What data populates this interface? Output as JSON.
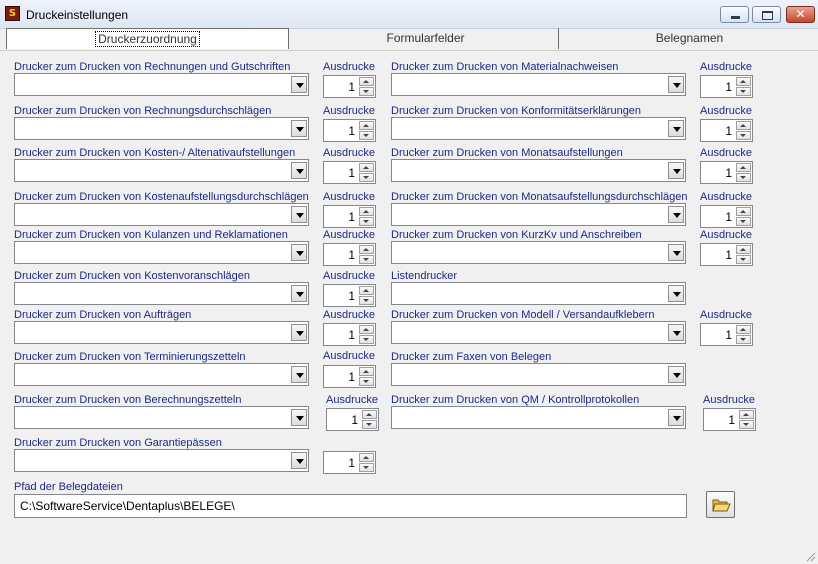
{
  "window": {
    "title": "Druckeinstellungen",
    "app_icon_glyph": "S",
    "close_glyph": "✕"
  },
  "tabs": [
    {
      "label": "Druckerzuordnung",
      "active": true
    },
    {
      "label": "Formularfelder",
      "active": false
    },
    {
      "label": "Belegnamen",
      "active": false
    }
  ],
  "left": [
    {
      "label": "Drucker zum Drucken von  Rechnungen und Gutschriften",
      "count_label": "Ausdrucke",
      "count": "1"
    },
    {
      "label": "Drucker zum Drucken von Rechnungsdurchschlägen",
      "count_label": "Ausdrucke",
      "count": "1"
    },
    {
      "label": "Drucker zum Drucken von  Kosten-/ Altenativaufstellungen",
      "count_label": "Ausdrucke",
      "count": "1"
    },
    {
      "label": "Drucker zum Drucken von Kostenaufstellungsdurchschlägen",
      "count_label": "Ausdrucke",
      "count": "1"
    },
    {
      "label": "Drucker zum Drucken von Kulanzen und Reklamationen",
      "count_label": "Ausdrucke",
      "count": "1"
    },
    {
      "label": "Drucker zum Drucken von Kostenvoranschlägen",
      "count_label": "Ausdrucke",
      "count": "1"
    },
    {
      "label": "Drucker zum Drucken von Aufträgen",
      "count_label": "Ausdrucke",
      "count": "1"
    },
    {
      "label": "Drucker zum Drucken von Terminierungszetteln",
      "count_label": "Ausdrucke",
      "count": "1"
    },
    {
      "label": "Drucker zum Drucken von Berechnungszetteln",
      "count_label": "Ausdrucke",
      "count": "1"
    },
    {
      "label": "Drucker zum Drucken von Garantiepässen",
      "count_label": "",
      "count": "1"
    }
  ],
  "right": [
    {
      "label": "Drucker zum Drucken von Materialnachweisen",
      "count_label": "Ausdrucke",
      "count": "1"
    },
    {
      "label": "Drucker zum Drucken von Konformitätserklärungen",
      "count_label": "Ausdrucke",
      "count": "1"
    },
    {
      "label": "Drucker zum Drucken von Monatsaufstellungen",
      "count_label": "Ausdrucke",
      "count": "1"
    },
    {
      "label": "Drucker zum Drucken von Monatsaufstellungsdurchschlägen",
      "count_label": "Ausdrucke",
      "count": "1"
    },
    {
      "label": "Drucker zum Drucken von KurzKv und Anschreiben",
      "count_label": "Ausdrucke",
      "count": "1"
    },
    {
      "label": "Listendrucker",
      "count_label": "",
      "count": ""
    },
    {
      "label": "Drucker zum Drucken von Modell / Versandaufklebern",
      "count_label": "Ausdrucke",
      "count": "1"
    },
    {
      "label": "Drucker zum Faxen von Belegen",
      "count_label": "",
      "count": ""
    },
    {
      "label": "Drucker zum Drucken von QM / Kontrollprotokollen",
      "count_label": "Ausdrucke",
      "count": "1"
    }
  ],
  "path": {
    "label": "Pfad der Belegdateien",
    "value": "C:\\SoftwareService\\Dentaplus\\BELEGE\\"
  }
}
